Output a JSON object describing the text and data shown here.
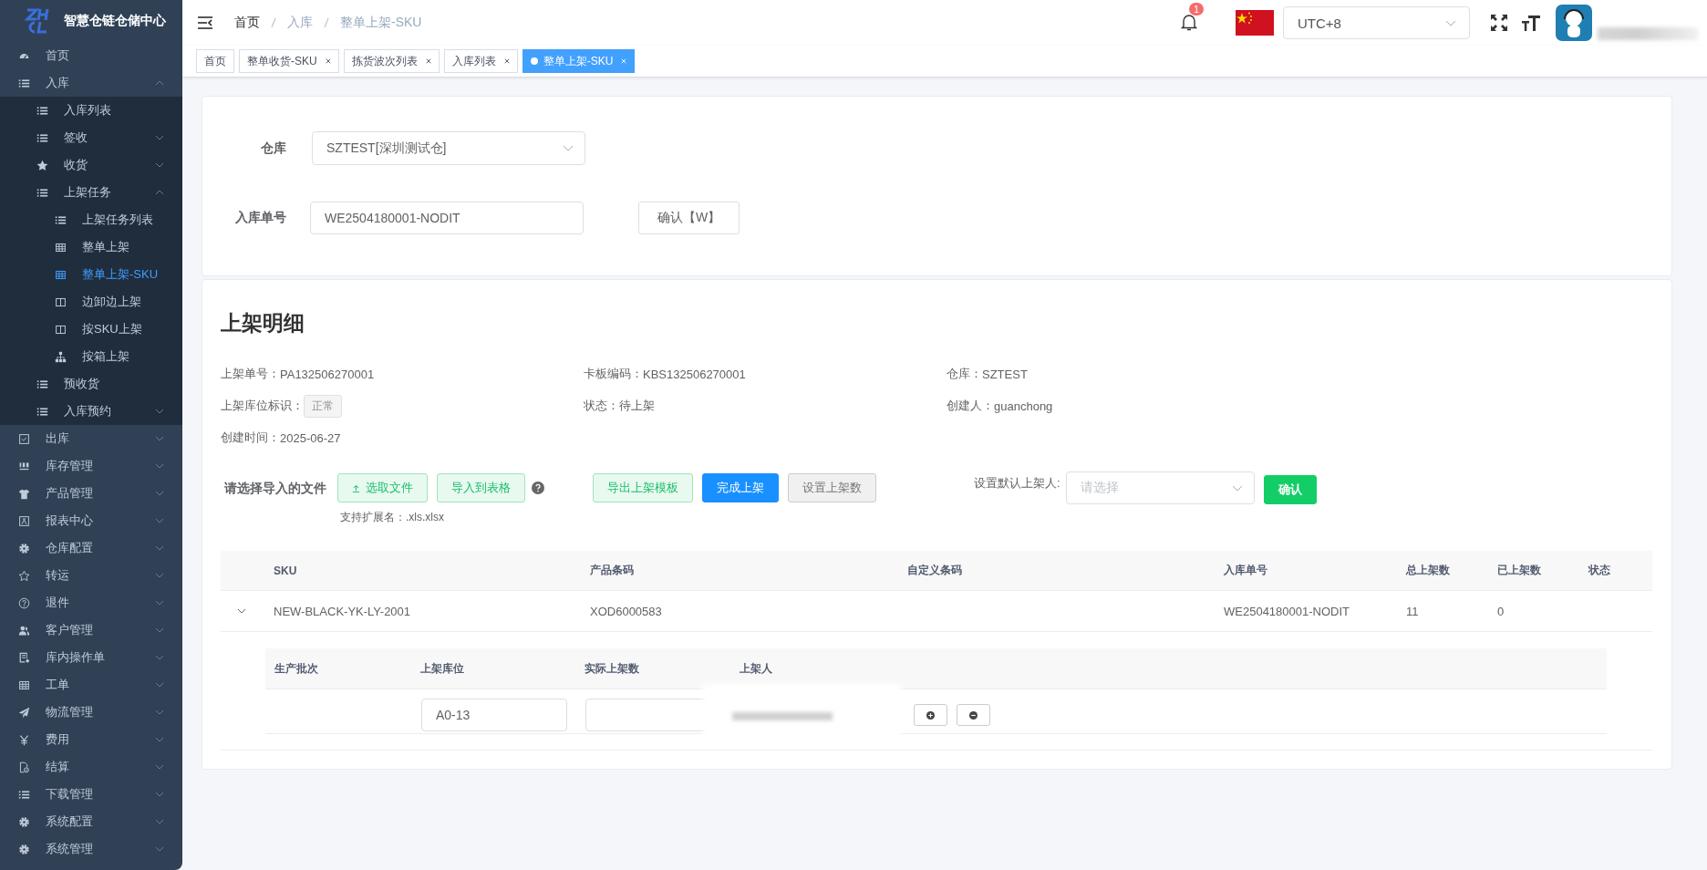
{
  "sidebar": {
    "logo_text": "智慧仓链仓储中心",
    "items": [
      {
        "label": "首页",
        "selected": false
      },
      {
        "label": "入库",
        "selected": false,
        "expanded": true,
        "children": [
          {
            "label": "入库列表",
            "selected": false
          },
          {
            "label": "签收",
            "selected": false,
            "expanded": false
          },
          {
            "label": "收货",
            "selected": false,
            "expanded": false
          },
          {
            "label": "上架任务",
            "selected": false,
            "expanded": true,
            "children": [
              {
                "label": "上架任务列表",
                "selected": false
              },
              {
                "label": "整单上架",
                "selected": false
              },
              {
                "label": "整单上架-SKU",
                "selected": true
              },
              {
                "label": "边卸边上架",
                "selected": false
              },
              {
                "label": "按SKU上架",
                "selected": false
              },
              {
                "label": "按箱上架",
                "selected": false
              }
            ]
          },
          {
            "label": "预收货",
            "selected": false
          },
          {
            "label": "入库预约",
            "selected": false,
            "expanded": false
          }
        ]
      },
      {
        "label": "出库",
        "selected": false,
        "expanded": false
      },
      {
        "label": "库存管理",
        "selected": false,
        "expanded": false
      },
      {
        "label": "产品管理",
        "selected": false,
        "expanded": false
      },
      {
        "label": "报表中心",
        "selected": false,
        "expanded": false
      },
      {
        "label": "仓库配置",
        "selected": false,
        "expanded": false
      },
      {
        "label": "转运",
        "selected": false,
        "expanded": false
      },
      {
        "label": "退件",
        "selected": false,
        "expanded": false
      },
      {
        "label": "客户管理",
        "selected": false,
        "expanded": false
      },
      {
        "label": "库内操作单",
        "selected": false,
        "expanded": false
      },
      {
        "label": "工单",
        "selected": false,
        "expanded": false
      },
      {
        "label": "物流管理",
        "selected": false,
        "expanded": false
      },
      {
        "label": "费用",
        "selected": false,
        "expanded": false
      },
      {
        "label": "结算",
        "selected": false,
        "expanded": false
      },
      {
        "label": "下载管理",
        "selected": false,
        "expanded": false
      },
      {
        "label": "系统配置",
        "selected": false,
        "expanded": false
      },
      {
        "label": "系统管理",
        "selected": false,
        "expanded": false
      }
    ]
  },
  "header": {
    "breadcrumb": [
      "首页",
      "入库",
      "整单上架-SKU"
    ],
    "notification_count": "1",
    "timezone": "UTC+8"
  },
  "tabs": [
    {
      "label": "首页",
      "selected": false,
      "closable": false
    },
    {
      "label": "整单收货-SKU",
      "selected": false,
      "closable": true
    },
    {
      "label": "拣货波次列表",
      "selected": false,
      "closable": true
    },
    {
      "label": "入库列表",
      "selected": false,
      "closable": true
    },
    {
      "label": "整单上架-SKU",
      "selected": true,
      "closable": true
    }
  ],
  "form": {
    "warehouse_label": "仓库",
    "warehouse_value": "SZTEST[深圳测试仓]",
    "order_label": "入库单号",
    "order_value": "WE2504180001-NODIT",
    "confirm_button": "确认【W】"
  },
  "details": {
    "title": "上架明细",
    "fields": [
      {
        "label": "上架单号：",
        "value": "PA132506270001"
      },
      {
        "label": "卡板编码：",
        "value": "KBS132506270001"
      },
      {
        "label": "仓库：",
        "value": "SZTEST"
      },
      {
        "label": "上架库位标识：",
        "tag": "正常"
      },
      {
        "label": "状态：",
        "value": "待上架"
      },
      {
        "label": "创建人：",
        "value": "guanchong"
      },
      {
        "label": "创建时间：",
        "value": "2025-06-27"
      }
    ],
    "import_label": "请选择导入的文件",
    "import_buttons": [
      {
        "label": "选取文件",
        "kind": "upload"
      },
      {
        "label": "导入到表格",
        "kind": "plain"
      }
    ],
    "import_hint": "支持扩展名：.xls.xlsx",
    "action_buttons": [
      {
        "label": "导出上架模板",
        "kind": "plain"
      },
      {
        "label": "完成上架",
        "kind": "primary"
      },
      {
        "label": "设置上架数",
        "kind": "default"
      }
    ],
    "default_label": "设置默认上架人:",
    "default_placeholder": "请选择",
    "default_button": "确认"
  },
  "table": {
    "columns": [
      "SKU",
      "产品条码",
      "自定义条码",
      "入库单号",
      "总上架数",
      "已上架数",
      "状态"
    ],
    "rows": [
      {
        "expanded": true,
        "sku": "NEW-BLACK-YK-LY-2001",
        "barcode": "XOD6000583",
        "inbound_no": "WE2504180001-NODIT",
        "total": "11",
        "done": "0"
      }
    ]
  },
  "sub_table": {
    "columns": [
      "生产批次",
      "上架库位",
      "实际上架数",
      "上架人"
    ],
    "rows": [
      {
        "location": "A0-13"
      }
    ]
  }
}
